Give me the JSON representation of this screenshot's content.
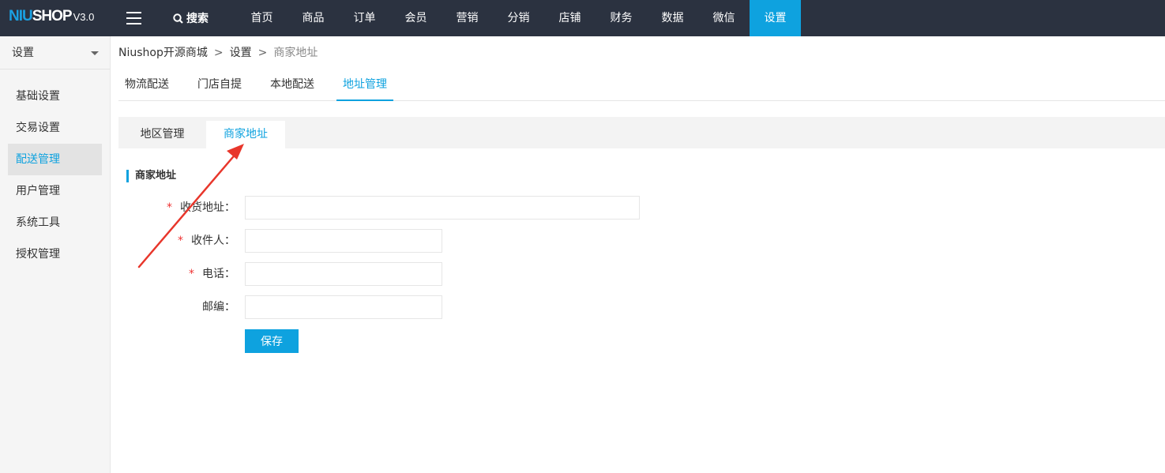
{
  "logo": {
    "part1": "NIU",
    "part2": "SHOP",
    "version": "V3.0"
  },
  "topbar": {
    "search_label": "搜索",
    "nav": [
      "首页",
      "商品",
      "订单",
      "会员",
      "营销",
      "分销",
      "店铺",
      "财务",
      "数据",
      "微信",
      "设置"
    ],
    "active_nav": "设置"
  },
  "sidebar": {
    "header": "设置",
    "items": [
      "基础设置",
      "交易设置",
      "配送管理",
      "用户管理",
      "系统工具",
      "授权管理"
    ],
    "active_item": "配送管理"
  },
  "breadcrumb": {
    "items": [
      "Niushop开源商城",
      "设置",
      "商家地址"
    ],
    "separator": ">"
  },
  "tabs": [
    "物流配送",
    "门店自提",
    "本地配送",
    "地址管理"
  ],
  "active_tab": "地址管理",
  "subtabs": [
    "地区管理",
    "商家地址"
  ],
  "active_subtab": "商家地址",
  "section_title": "商家地址",
  "form": {
    "fields": [
      {
        "label": "收货地址：",
        "required": true,
        "value": ""
      },
      {
        "label": "收件人：",
        "required": true,
        "value": ""
      },
      {
        "label": "电话：",
        "required": true,
        "value": ""
      },
      {
        "label": "邮编：",
        "required": false,
        "value": ""
      }
    ],
    "required_mark": "*",
    "save_label": "保存"
  },
  "colors": {
    "accent": "#0ea2df",
    "topbar": "#2b3240",
    "annotation": "#e8362b"
  }
}
